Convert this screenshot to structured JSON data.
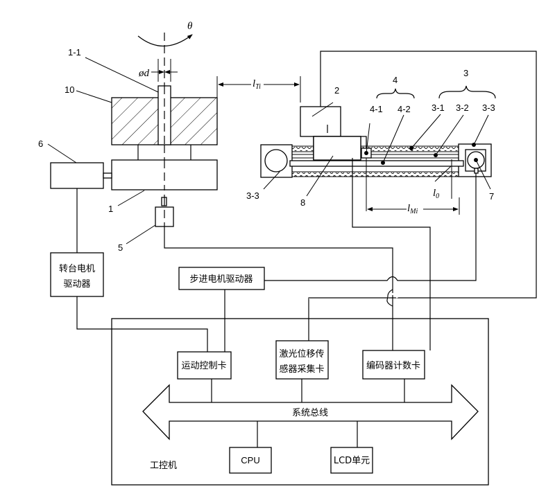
{
  "diagram": {
    "title": "",
    "symbols": {
      "rotation_angle": "θ",
      "diameter": "ød",
      "l_T_base": "l",
      "l_T_sub": "Ti",
      "l_M_base": "l",
      "l_M_sub": "Mi",
      "l_0_base": "l",
      "l_0_sub": "0"
    },
    "part_labels": {
      "p1": "1",
      "p1_1": "1-1",
      "p2": "2",
      "p3": "3",
      "p3_1": "3-1",
      "p3_2": "3-2",
      "p3_3_right": "3-3",
      "p3_3_left": "3-3",
      "p4": "4",
      "p4_1": "4-1",
      "p4_2": "4-2",
      "p5": "5",
      "p6": "6",
      "p7": "7",
      "p8": "8",
      "p10": "10"
    },
    "blocks": {
      "turntable_driver_line1": "转台电机",
      "turntable_driver_line2": "驱动器",
      "stepper_driver": "步进电机驱动器",
      "motion_card": "运动控制卡",
      "laser_card_line1": "激光位移传",
      "laser_card_line2": "感器采集卡",
      "encoder_card": "编码器计数卡",
      "system_bus": "系统总线",
      "cpu": "CPU",
      "lcd": "LCD单元",
      "ipc": "工控机"
    }
  }
}
